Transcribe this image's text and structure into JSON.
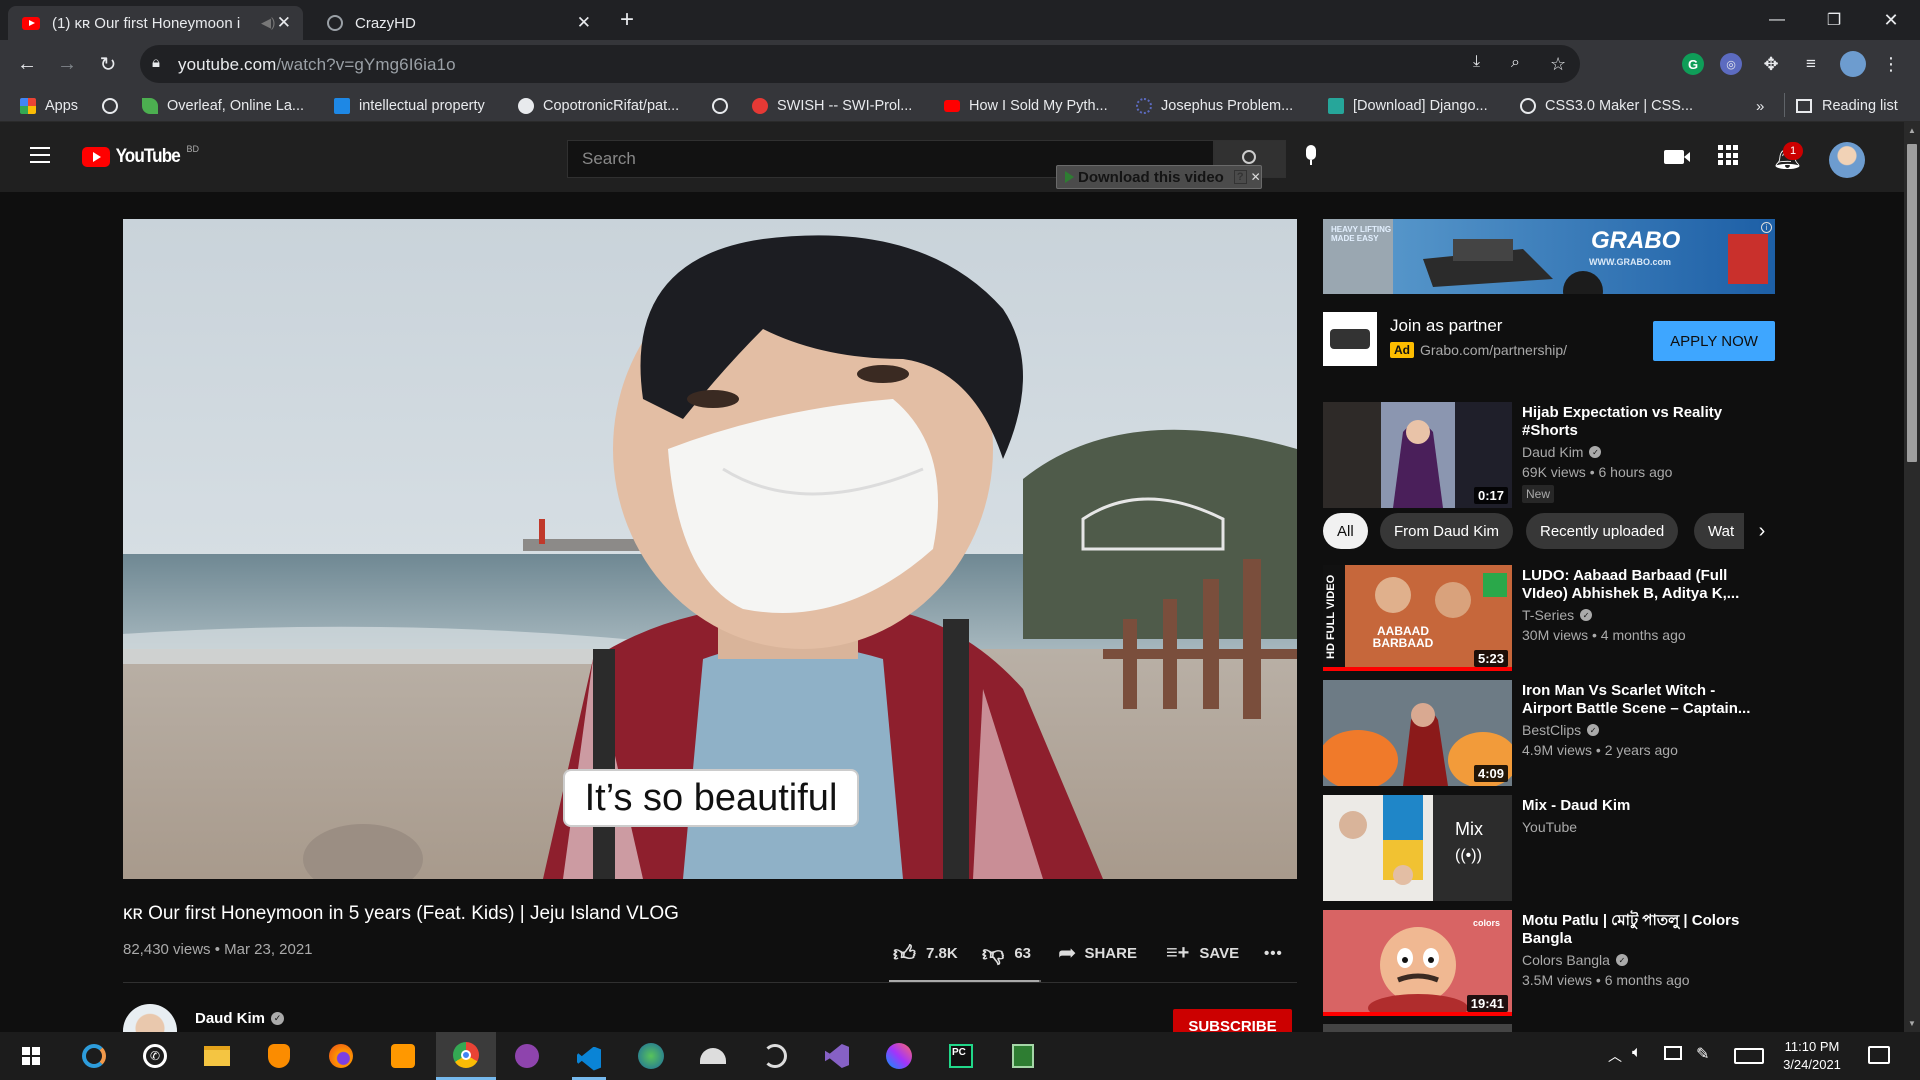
{
  "browser": {
    "tabs": [
      {
        "title": "(1) ĸʀ Our first Honeymoon i",
        "active": true
      },
      {
        "title": "CrazyHD",
        "active": false
      }
    ],
    "new_tab": "+",
    "url_host": "youtube.com",
    "url_path": "/watch?v=gYmg6I6ia1o",
    "bookmarks": [
      {
        "label": "Apps",
        "color": "#4285f4"
      },
      {
        "label": "",
        "color": "#e8eaed"
      },
      {
        "label": "Overleaf, Online La...",
        "color": "#4caf50"
      },
      {
        "label": "intellectual property",
        "color": "#1e88e5"
      },
      {
        "label": "CopotronicRifat/pat...",
        "color": "#e8eaed"
      },
      {
        "label": "",
        "color": "#e8eaed"
      },
      {
        "label": "SWISH -- SWI-Prol...",
        "color": "#e53935"
      },
      {
        "label": "How I Sold My Pyth...",
        "color": "#ff0000"
      },
      {
        "label": "Josephus Problem...",
        "color": "#5c6bc0"
      },
      {
        "label": "[Download] Django...",
        "color": "#26a69a"
      },
      {
        "label": "CSS3.0 Maker | CSS...",
        "color": "#e8eaed"
      }
    ],
    "bookmarks_more": "»",
    "reading_list": "Reading list"
  },
  "youtube": {
    "logo": "YouTube",
    "country": "BD",
    "search_placeholder": "Search",
    "download_bar": "Download this video",
    "notification_count": "1",
    "caption": "It’s so beautiful",
    "video_title": "ĸʀ Our first Honeymoon in 5 years (Feat. Kids) | Jeju Island VLOG",
    "views_date": "82,430 views • Mar 23, 2021",
    "likes": "7.8K",
    "dislikes": "63",
    "share": "SHARE",
    "save": "SAVE",
    "more": "•••",
    "channel": "Daud Kim",
    "subscribe": "SUBSCRIBE",
    "ad": {
      "banner_brand": "GRABO",
      "banner_site": "WWW.GRABO.com",
      "banner_tag": "HEAVY LIFTING MADE EASY",
      "title": "Join as partner",
      "badge": "Ad",
      "url": "Grabo.com/partnership/",
      "cta": "APPLY NOW"
    },
    "chips": [
      "All",
      "From Daud Kim",
      "Recently uploaded",
      "Wat"
    ],
    "recs": [
      {
        "title": "Hijab Expectation vs Reality #Shorts",
        "channel": "Daud Kim",
        "stats": "69K views • 6 hours ago",
        "badge": "New",
        "duration": "0:17",
        "verified": true
      },
      {
        "title": "LUDO: Aabaad Barbaad (Full VIdeo) Abhishek B, Aditya K,...",
        "channel": "T-Series",
        "stats": "30M views • 4 months ago",
        "duration": "5:23",
        "verified": true,
        "thumb_side": "HD FULL VIDEO",
        "thumb_text": "AABAAD BARBAAD"
      },
      {
        "title": "Iron Man Vs Scarlet Witch - Airport Battle Scene – Captain...",
        "channel": "BestClips",
        "stats": "4.9M views • 2 years ago",
        "duration": "4:09",
        "verified": true
      },
      {
        "title": "Mix - Daud Kim",
        "channel": "YouTube",
        "stats": "",
        "duration": "",
        "mix_label": "Mix",
        "verified": false
      },
      {
        "title": "Motu Patlu | মোটু পাতলু | Colors Bangla",
        "channel": "Colors Bangla",
        "stats": "3.5M views • 6 months ago",
        "duration": "19:41",
        "verified": true,
        "thumb_tag": "colors"
      }
    ]
  },
  "taskbar": {
    "time": "11:10 PM",
    "date": "3/24/2021"
  }
}
